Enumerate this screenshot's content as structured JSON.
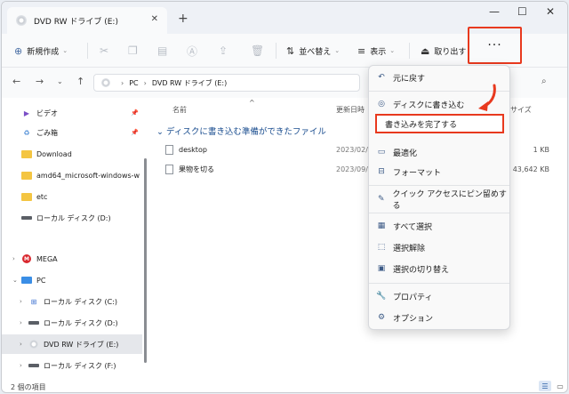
{
  "window": {
    "tab_title": "DVD RW ドライブ (E:)",
    "tab_close": "✕",
    "new_tab": "+",
    "minimize": "—",
    "maximize": "☐",
    "close": "✕"
  },
  "toolbar": {
    "new_label": "新規作成",
    "sort_label": "並べ替え",
    "view_label": "表示",
    "eject_label": "取り出す",
    "more_label": "···"
  },
  "address": {
    "root": "PC",
    "current": "DVD RW ドライブ (E:)"
  },
  "sidebar": {
    "items": [
      {
        "label": "ビデオ"
      },
      {
        "label": "ごみ箱"
      },
      {
        "label": "Download"
      },
      {
        "label": "amd64_microsoft-windows-w"
      },
      {
        "label": "etc"
      },
      {
        "label": "ローカル ディスク (D:)"
      },
      {
        "label": "MEGA"
      },
      {
        "label": "PC"
      },
      {
        "label": "ローカル ディスク (C:)"
      },
      {
        "label": "ローカル ディスク (D:)"
      },
      {
        "label": "DVD RW ドライブ (E:)"
      },
      {
        "label": "ローカル ディスク (F:)"
      }
    ]
  },
  "columns": {
    "name": "名前",
    "date": "更新日時",
    "size": "サイズ"
  },
  "files": {
    "group_title": "ディスクに書き込む準備ができたファイル",
    "rows": [
      {
        "name": "desktop",
        "date": "2023/02/2",
        "size": "1 KB"
      },
      {
        "name": "果物を切る",
        "date": "2023/09/",
        "size": "43,642 KB"
      }
    ]
  },
  "status": {
    "count": "2 個の項目"
  },
  "menu": {
    "items": [
      {
        "label": "元に戻す"
      },
      {
        "label": "ディスクに書き込む"
      },
      {
        "label": "書き込みを完了する"
      },
      {
        "label": "最適化"
      },
      {
        "label": "フォーマット"
      },
      {
        "label": "クイック アクセスにピン留めする"
      },
      {
        "label": "すべて選択"
      },
      {
        "label": "選択解除"
      },
      {
        "label": "選択の切り替え"
      },
      {
        "label": "プロパティ"
      },
      {
        "label": "オプション"
      }
    ]
  },
  "colors": {
    "highlight": "#e8391e",
    "accent": "#1a4d8f"
  }
}
